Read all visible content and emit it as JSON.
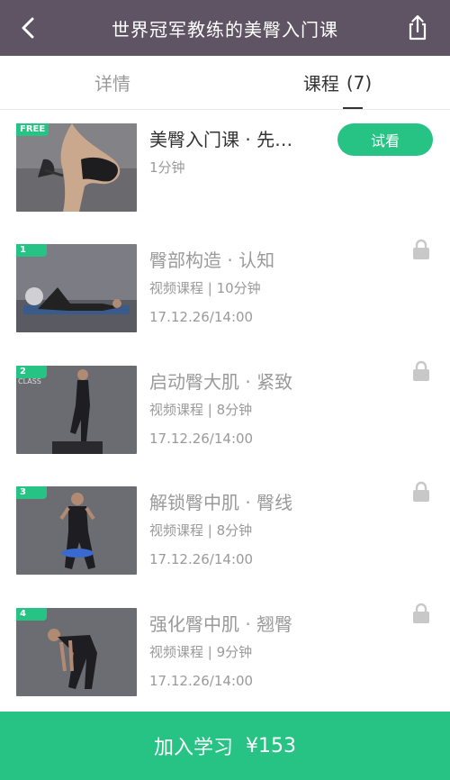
{
  "header": {
    "title": "世界冠军教练的美臀入门课",
    "back_icon": "chevron-left-icon",
    "share_icon": "share-icon"
  },
  "tabs": [
    {
      "label": "详情",
      "count": ""
    },
    {
      "label": "课程",
      "count": "(7)"
    }
  ],
  "lessons": [
    {
      "badge": "FREE",
      "name": "美臀入门课 · 先…",
      "meta": "1分钟",
      "date": "",
      "action": "试看",
      "locked": false
    },
    {
      "badge": "1",
      "name": "臀部构造 · 认知",
      "meta": "视频课程 | 10分钟",
      "date": "17.12.26/14:00",
      "locked": true
    },
    {
      "badge": "2",
      "name": "启动臀大肌 · 紧致",
      "meta": "视频课程 | 8分钟",
      "date": "17.12.26/14:00",
      "locked": true
    },
    {
      "badge": "3",
      "name": "解锁臀中肌 · 臀线",
      "meta": "视频课程 | 8分钟",
      "date": "17.12.26/14:00",
      "locked": true
    },
    {
      "badge": "4",
      "name": "强化臀中肌 · 翘臀",
      "meta": "视频课程 | 9分钟",
      "date": "17.12.26/14:00",
      "locked": true
    }
  ],
  "footer": {
    "label": "加入学习",
    "price": "¥153"
  },
  "colors": {
    "header_bg": "#5f5464",
    "accent": "#27c384"
  }
}
